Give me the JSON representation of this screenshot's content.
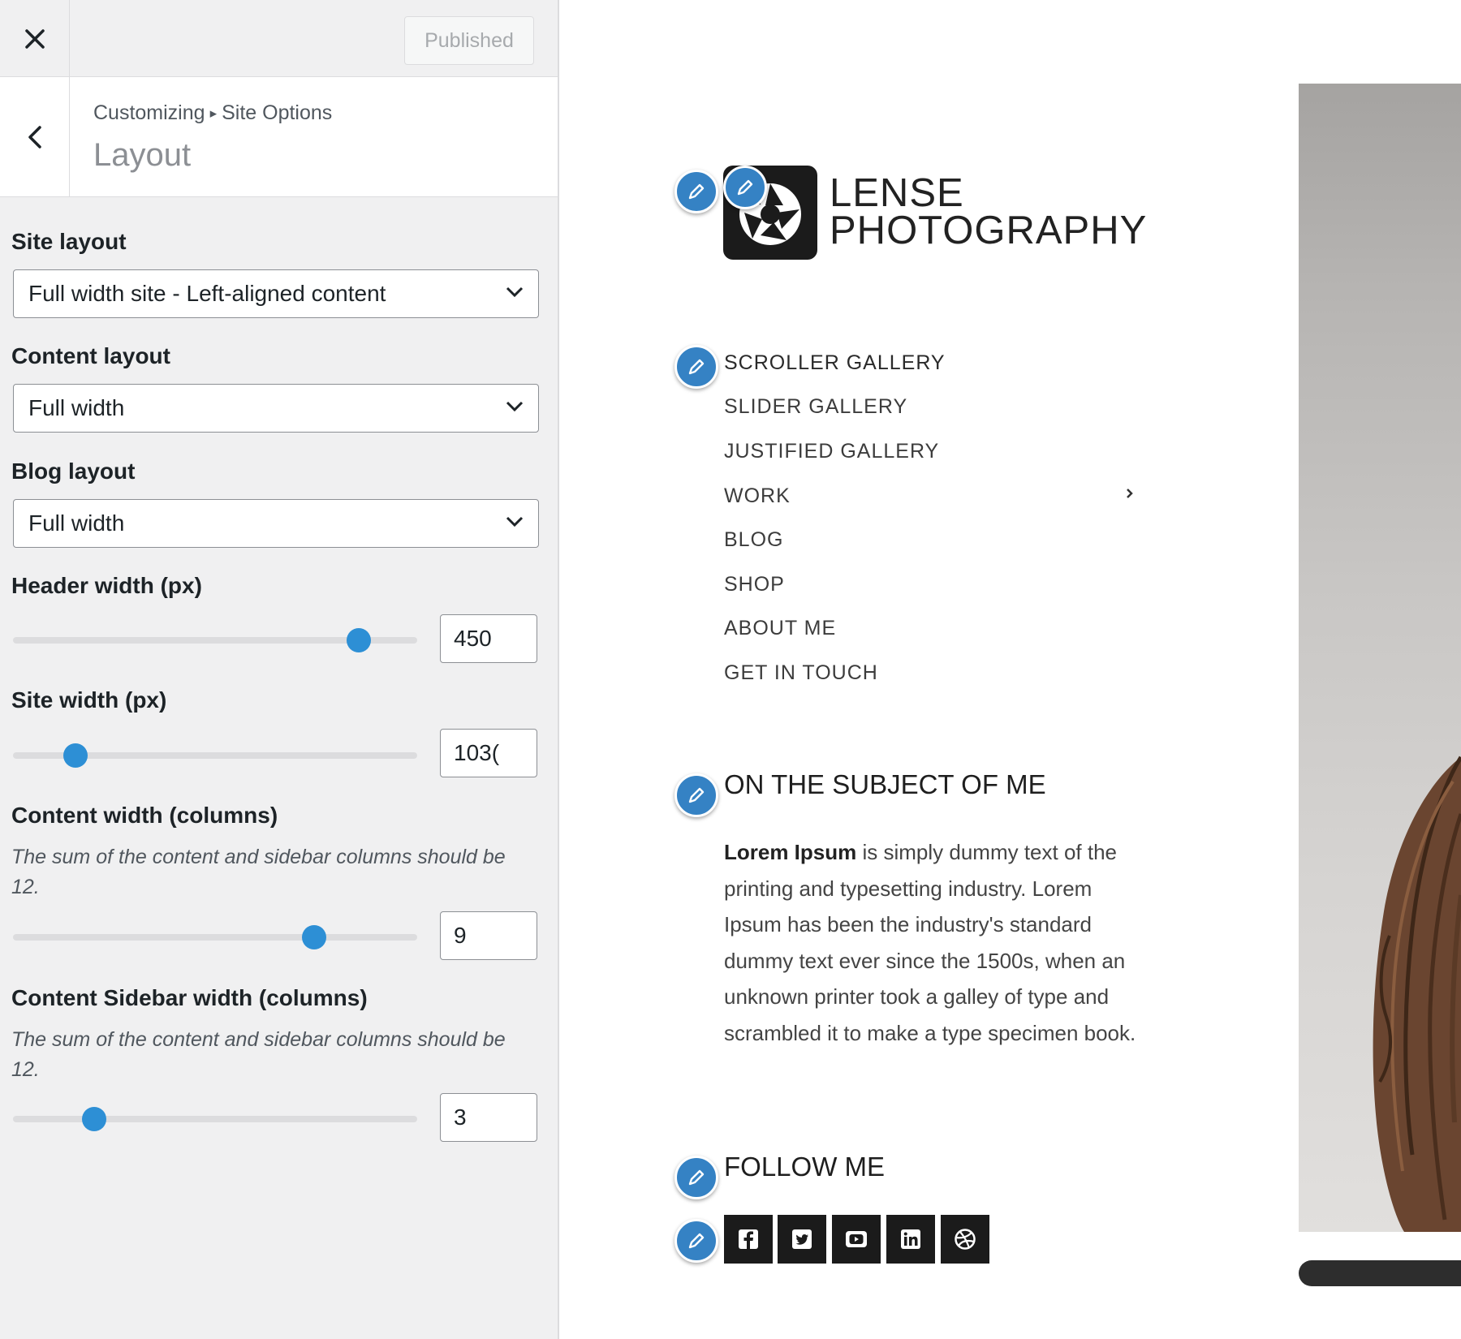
{
  "customizer": {
    "publish_label": "Published",
    "breadcrumb": {
      "root": "Customizing",
      "separator": "▸",
      "parent": "Site Options"
    },
    "section_title": "Layout",
    "controls": {
      "site_layout": {
        "label": "Site layout",
        "value": "Full width site - Left-aligned content"
      },
      "content_layout": {
        "label": "Content layout",
        "value": "Full width"
      },
      "blog_layout": {
        "label": "Blog layout",
        "value": "Full width"
      },
      "header_width": {
        "label": "Header width (px)",
        "value": "450",
        "slider_fraction": 0.855
      },
      "site_width": {
        "label": "Site width (px)",
        "value": "103(",
        "slider_fraction": 0.155
      },
      "content_width": {
        "label": "Content width (columns)",
        "description": "The sum of the content and sidebar columns should be 12.",
        "value": "9",
        "slider_fraction": 0.745
      },
      "sidebar_width": {
        "label": "Content Sidebar width (columns)",
        "description": "The sum of the content and sidebar columns should be 12.",
        "value": "3",
        "slider_fraction": 0.2
      }
    }
  },
  "preview": {
    "logo": {
      "line1": "LENSE",
      "line2": "PHOTOGRAPHY"
    },
    "nav": [
      "SCROLLER GALLERY",
      "SLIDER GALLERY",
      "JUSTIFIED GALLERY",
      "WORK",
      "BLOG",
      "SHOP",
      "ABOUT ME",
      "GET IN TOUCH"
    ],
    "about": {
      "title": "ON THE SUBJECT OF ME",
      "bold_lead": "Lorem Ipsum",
      "text": " is simply dummy text of the printing and typesetting industry. Lorem Ipsum has been the industry's standard dummy text ever since the 1500s, when an unknown printer took a galley of type and scrambled it to make a type specimen book."
    },
    "follow": {
      "title": "FOLLOW ME",
      "icons": [
        "facebook-icon",
        "twitter-icon",
        "youtube-icon",
        "linkedin-icon",
        "dribbble-icon"
      ]
    }
  },
  "colors": {
    "accent": "#2d8fd5",
    "edit_shortcut": "#3582c4",
    "sidebar_bg": "#f0f0f1"
  }
}
